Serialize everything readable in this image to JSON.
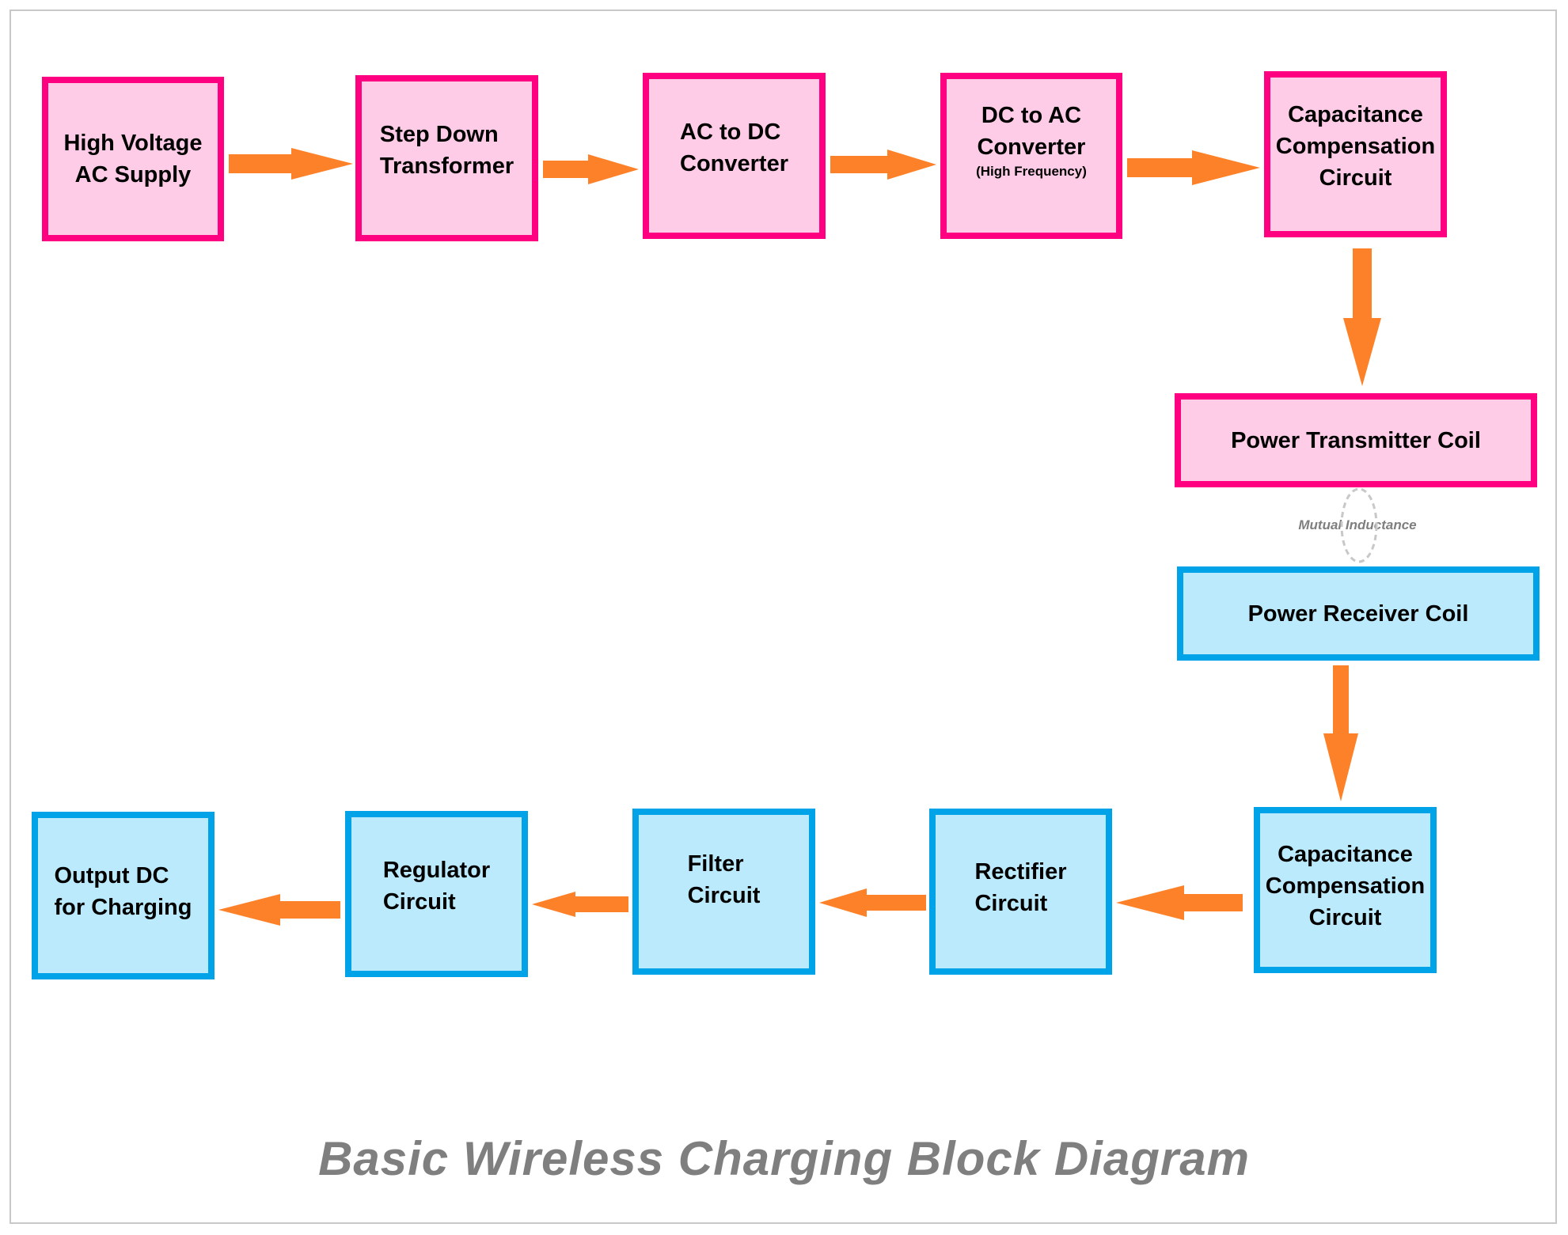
{
  "diagram": {
    "title": "Basic Wireless Charging Block Diagram",
    "colors": {
      "transmitter_fill": "#ffcce8",
      "transmitter_border": "#ff0080",
      "receiver_fill": "#bbeafc",
      "receiver_border": "#00a2e8",
      "arrow": "#fd8128",
      "annotation": "#7f7f7f",
      "coupling_ellipse": "#c8c8c8"
    },
    "transmitter_blocks": [
      {
        "id": "hv-ac-supply",
        "label": "High Voltage\nAC Supply"
      },
      {
        "id": "step-down-transformer",
        "label": "Step Down\nTransformer"
      },
      {
        "id": "ac-to-dc-converter",
        "label": "AC to DC\nConverter"
      },
      {
        "id": "dc-to-ac-converter",
        "label": "DC to AC\nConverter",
        "sublabel": "(High Frequency)"
      },
      {
        "id": "tx-capacitance-compensation",
        "label": "Capacitance\nCompensation\nCircuit"
      },
      {
        "id": "power-transmitter-coil",
        "label": "Power Transmitter Coil"
      }
    ],
    "coupling": {
      "label": "Mutual Inductance"
    },
    "receiver_blocks": [
      {
        "id": "power-receiver-coil",
        "label": "Power Receiver Coil"
      },
      {
        "id": "rx-capacitance-compensation",
        "label": "Capacitance\nCompensation\nCircuit"
      },
      {
        "id": "rectifier-circuit",
        "label": "Rectifier\nCircuit"
      },
      {
        "id": "filter-circuit",
        "label": "Filter\nCircuit"
      },
      {
        "id": "regulator-circuit",
        "label": "Regulator\nCircuit"
      },
      {
        "id": "output-dc",
        "label": "Output DC\nfor Charging"
      }
    ],
    "connections": [
      {
        "from": "hv-ac-supply",
        "to": "step-down-transformer"
      },
      {
        "from": "step-down-transformer",
        "to": "ac-to-dc-converter"
      },
      {
        "from": "ac-to-dc-converter",
        "to": "dc-to-ac-converter"
      },
      {
        "from": "dc-to-ac-converter",
        "to": "tx-capacitance-compensation"
      },
      {
        "from": "tx-capacitance-compensation",
        "to": "power-transmitter-coil"
      },
      {
        "from": "power-transmitter-coil",
        "to": "power-receiver-coil",
        "type": "mutual-inductance"
      },
      {
        "from": "power-receiver-coil",
        "to": "rx-capacitance-compensation"
      },
      {
        "from": "rx-capacitance-compensation",
        "to": "rectifier-circuit"
      },
      {
        "from": "rectifier-circuit",
        "to": "filter-circuit"
      },
      {
        "from": "filter-circuit",
        "to": "regulator-circuit"
      },
      {
        "from": "regulator-circuit",
        "to": "output-dc"
      }
    ]
  }
}
